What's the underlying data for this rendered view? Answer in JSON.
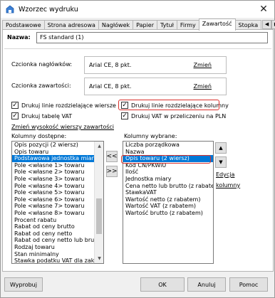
{
  "window": {
    "title": "Wzorzec wydruku",
    "close_glyph": "✕"
  },
  "tabs": [
    "Podstawowe",
    "Strona adresowa",
    "Nagłówek",
    "Papier",
    "Tytuł",
    "Firmy",
    "Zawartość",
    "Stopka"
  ],
  "active_tab": "Zawartość",
  "name_field": {
    "label": "Nazwa:",
    "value": "FS standard (1)"
  },
  "fonts": {
    "header": {
      "label": "Czcionka nagłówków:",
      "value": "Arial CE, 8 pkt.",
      "change": "Zmień"
    },
    "content": {
      "label": "Czcionka zawartości:",
      "value": "Arial CE, 8 pkt.",
      "change": "Zmień"
    }
  },
  "checkboxes": {
    "row_lines": {
      "label": "Drukuj linie rozdzielające wiersze",
      "checked": true
    },
    "col_lines": {
      "label": "Drukuj linie rozdzielające kolumny",
      "checked": true
    },
    "vat_table": {
      "label": "Drukuj tabelę VAT",
      "checked": true
    },
    "vat_pln": {
      "label": "Drukuj VAT w przeliczeniu na PLN",
      "checked": true
    }
  },
  "row_height_link": "Zmień wysokość wierszy zawartości",
  "available": {
    "label": "Kolumny dostępne:",
    "selected_index": 2,
    "items": [
      "Opis pozycji (2 wiersz)",
      "Opis towaru",
      "Podstawowa jednostka miary",
      "Pole <własne 1> towaru",
      "Pole <własne 2> towaru",
      "Pole <własne 3> towaru",
      "Pole <własne 4> towaru",
      "Pole <własne 5> towaru",
      "Pole <własne 6> towaru",
      "Pole <własne 7> towaru",
      "Pole <własne 8> towaru",
      "Procent rabatu",
      "Rabat od ceny brutto",
      "Rabat od ceny netto",
      "Rabat od ceny netto lub brutt",
      "Rodzaj towaru",
      "Stan minimalny",
      "Stawka podatku VAT dla zaku"
    ]
  },
  "move_buttons": {
    "remove": "<<",
    "add": ">>"
  },
  "selected": {
    "label": "Kolumny wybrane:",
    "selected_index": 2,
    "items": [
      "Liczba porządkowa",
      "Nazwa",
      "Opis towaru (2 wiersz)",
      "Kod CN/PKWiU",
      "Ilość",
      "Jednostka miary",
      "Cena netto lub brutto (z rabatem",
      "StawkaVAT",
      "Wartość netto (z rabatem)",
      "Wartość VAT (z rabatem)",
      "Wartość brutto (z rabatem)"
    ]
  },
  "order_buttons": {
    "up": "▲",
    "down": "▼"
  },
  "edit_columns": {
    "line1": "Edycja",
    "line2": "kolumny"
  },
  "footer": {
    "preview": "Wyprobuj",
    "ok": "OK",
    "cancel": "Anuluj",
    "help": "Pomoc"
  },
  "colors": {
    "selection": "#0078d7",
    "highlight_border": "#d9302b"
  }
}
